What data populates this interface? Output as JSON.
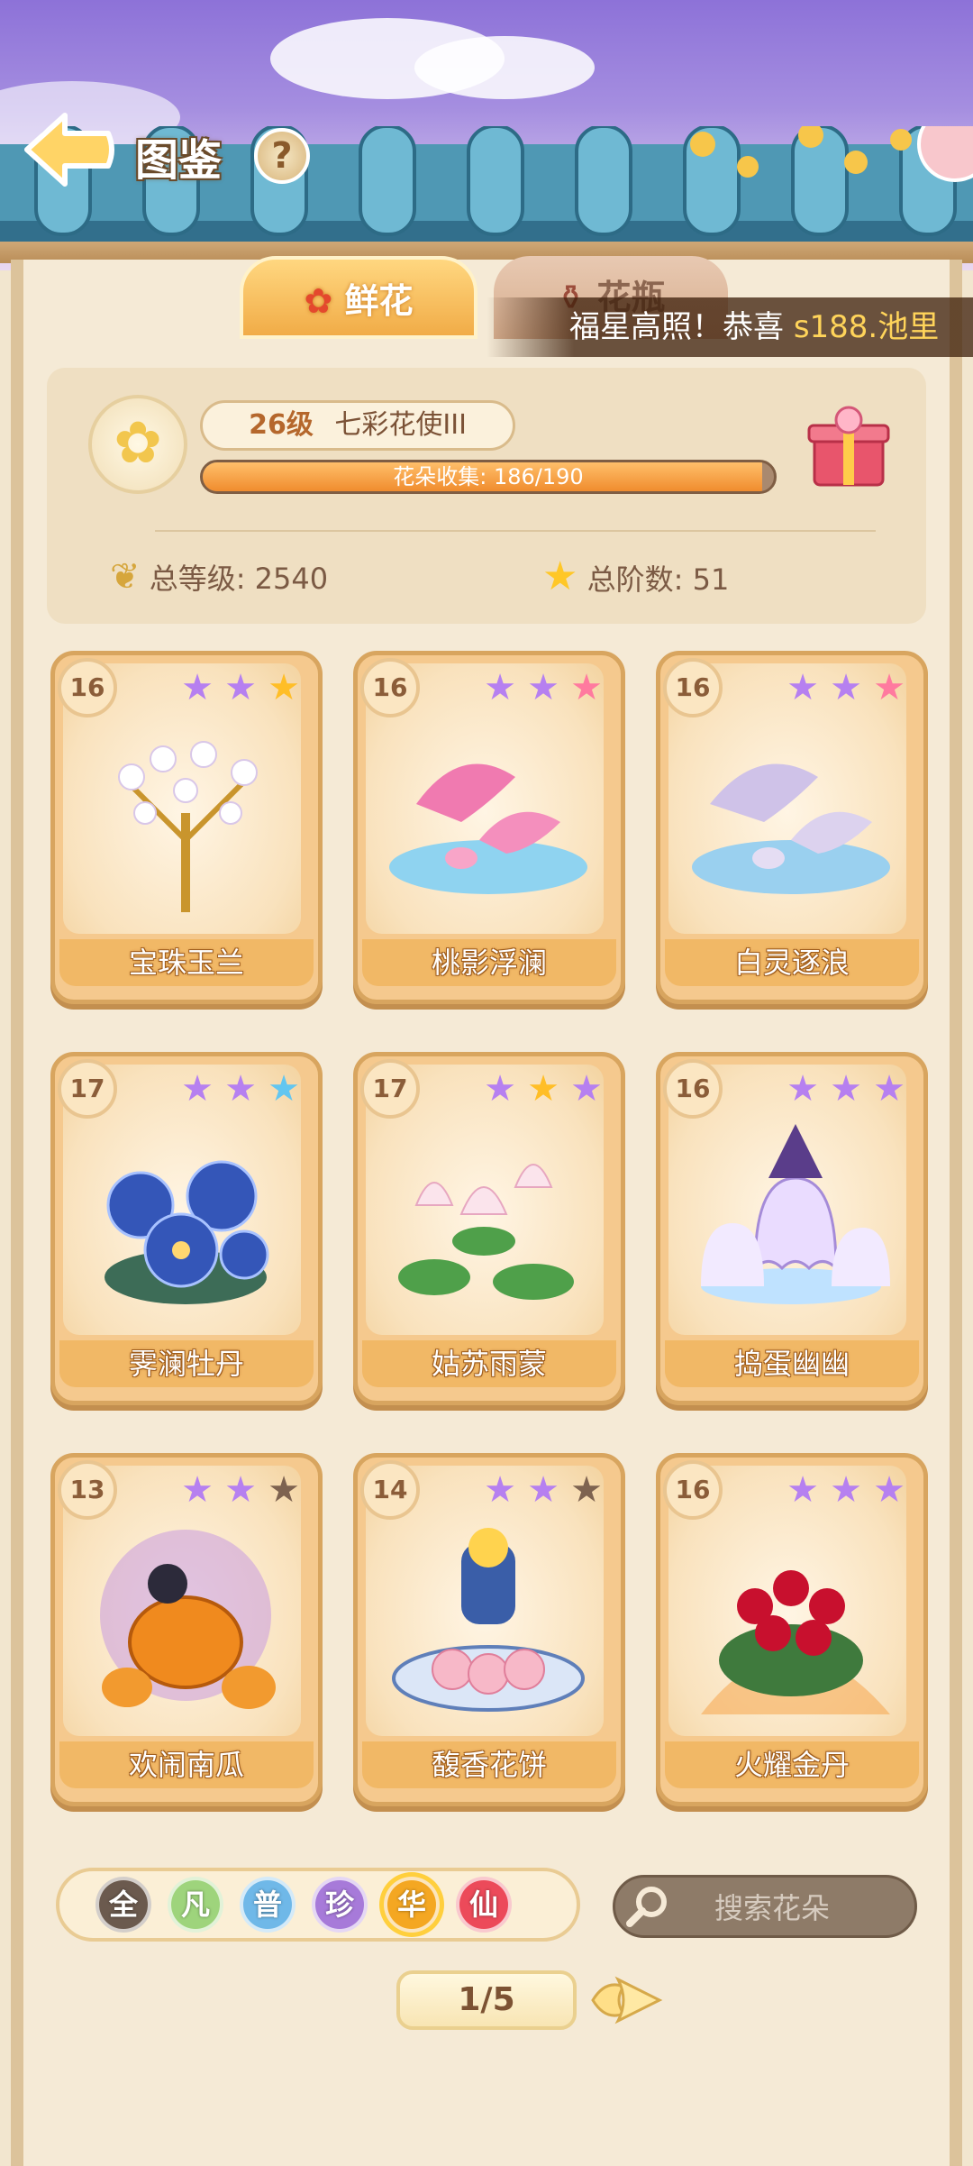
{
  "header": {
    "title": "图鉴",
    "help_label": "?"
  },
  "tabs": [
    {
      "label": "鲜花",
      "active": true
    },
    {
      "label": "花瓶",
      "active": false
    }
  ],
  "marquee": {
    "message": "福星高照！恭喜",
    "player": "s188.池里"
  },
  "profile": {
    "level": "26级",
    "rank_title": "七彩花使III",
    "collection_label": "花朵收集: 186/190",
    "collection_progress": 0.979,
    "total_level": "总等级: 2540",
    "total_stars": "总阶数: 51"
  },
  "cards": [
    {
      "name": "宝珠玉兰",
      "level": "16",
      "stars": [
        "purple",
        "purple",
        "gold"
      ],
      "art": "magnolia"
    },
    {
      "name": "桃影浮澜",
      "level": "16",
      "stars": [
        "purple",
        "purple",
        "pink"
      ],
      "art": "pinkdolphin"
    },
    {
      "name": "白灵逐浪",
      "level": "16",
      "stars": [
        "purple",
        "purple",
        "pink"
      ],
      "art": "whitedolphin"
    },
    {
      "name": "霁澜牡丹",
      "level": "17",
      "stars": [
        "purple",
        "purple",
        "blue"
      ],
      "art": "peony"
    },
    {
      "name": "姑苏雨蒙",
      "level": "17",
      "stars": [
        "purple",
        "gold",
        "purple"
      ],
      "art": "lotus"
    },
    {
      "name": "捣蛋幽幽",
      "level": "16",
      "stars": [
        "purple",
        "purple",
        "purple"
      ],
      "art": "ghost"
    },
    {
      "name": "欢闹南瓜",
      "level": "13",
      "stars": [
        "purple",
        "purple",
        "brown"
      ],
      "art": "pumpkin"
    },
    {
      "name": "馥香花饼",
      "level": "14",
      "stars": [
        "purple",
        "purple",
        "brown"
      ],
      "art": "cake"
    },
    {
      "name": "火耀金丹",
      "level": "16",
      "stars": [
        "purple",
        "purple",
        "purple"
      ],
      "art": "redflower"
    }
  ],
  "filters": [
    {
      "label": "全",
      "color": "#6b5a4e",
      "selected": false
    },
    {
      "label": "凡",
      "color": "#9ed47c",
      "selected": false
    },
    {
      "label": "普",
      "color": "#6fb8e8",
      "selected": false
    },
    {
      "label": "珍",
      "color": "#a77ad9",
      "selected": false
    },
    {
      "label": "华",
      "color": "#f4a722",
      "selected": true
    },
    {
      "label": "仙",
      "color": "#ec4a5a",
      "selected": false
    }
  ],
  "search": {
    "placeholder": "搜索花朵"
  },
  "pager": {
    "label": "1/5"
  },
  "star_colors": {
    "purple": "#b680f0",
    "gold": "#ffbe27",
    "pink": "#ff7a9f",
    "blue": "#63c6f0",
    "brown": "#7e6350"
  }
}
